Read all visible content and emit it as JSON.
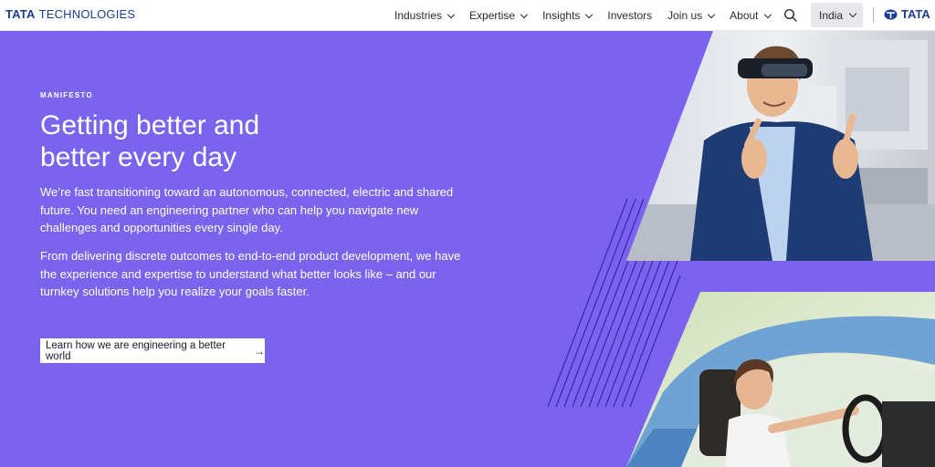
{
  "brand": {
    "logo_bold": "TATA",
    "logo_text": "TECHNOLOGIES",
    "right_logo": "TATA"
  },
  "nav": {
    "items": [
      {
        "label": "Industries",
        "has_dropdown": true
      },
      {
        "label": "Expertise",
        "has_dropdown": true
      },
      {
        "label": "Insights",
        "has_dropdown": true
      },
      {
        "label": "Investors",
        "has_dropdown": false
      },
      {
        "label": "Join us",
        "has_dropdown": true
      },
      {
        "label": "About",
        "has_dropdown": true
      }
    ],
    "country": "India"
  },
  "hero": {
    "eyebrow": "MANIFESTO",
    "headline_line1": "Getting better and",
    "headline_line2": "better every day",
    "para1": "We’re fast transitioning toward an autonomous, connected, electric and shared future. You need an engineering partner who can help you navigate new challenges and opportunities every single day.",
    "para2": "From delivering discrete outcomes to end-to-end product development, we have the experience and expertise to understand what better looks like – and our turnkey solutions help you realize your goals faster.",
    "cta": "Learn how we are engineering a better world",
    "cta_icon": "arrow-right-icon"
  },
  "colors": {
    "hero_bg": "#7b63ee",
    "brand_blue": "#1c3f94",
    "nav_bg": "#ffffff"
  }
}
